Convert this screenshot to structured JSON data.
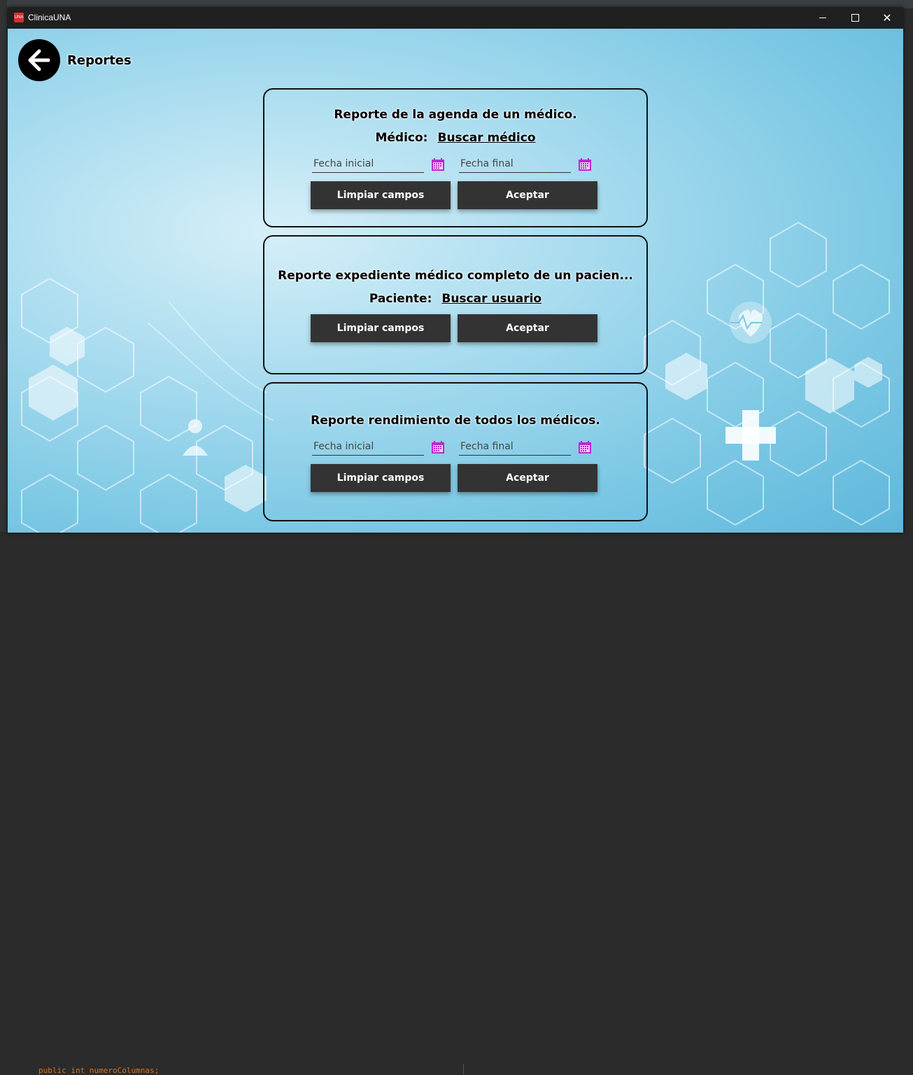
{
  "window": {
    "title": "ClinicaUNA",
    "icon_text": "UNA"
  },
  "header": {
    "title": "Reportes"
  },
  "cards": [
    {
      "title": "Reporte de la agenda de un médico.",
      "field_label": "Médico:",
      "field_link": "Buscar médico",
      "start_placeholder": "Fecha inicial",
      "end_placeholder": "Fecha final",
      "clear_label": "Limpiar campos",
      "accept_label": "Aceptar"
    },
    {
      "title": "Reporte expediente médico completo de un pacien...",
      "field_label": "Paciente:",
      "field_link": "Buscar usuario",
      "clear_label": "Limpiar campos",
      "accept_label": "Aceptar"
    },
    {
      "title": "Reporte rendimiento de todos los médicos.",
      "start_placeholder": "Fecha inicial",
      "end_placeholder": "Fecha final",
      "clear_label": "Limpiar campos",
      "accept_label": "Aceptar"
    }
  ],
  "icons": {
    "back": "arrow-left-icon",
    "calendar": "calendar-icon"
  },
  "colors": {
    "accent_calendar": "#c026d3",
    "button_bg": "#333333",
    "border": "#111111"
  },
  "ide": {
    "code_line": "public int numeroColumnas;"
  }
}
